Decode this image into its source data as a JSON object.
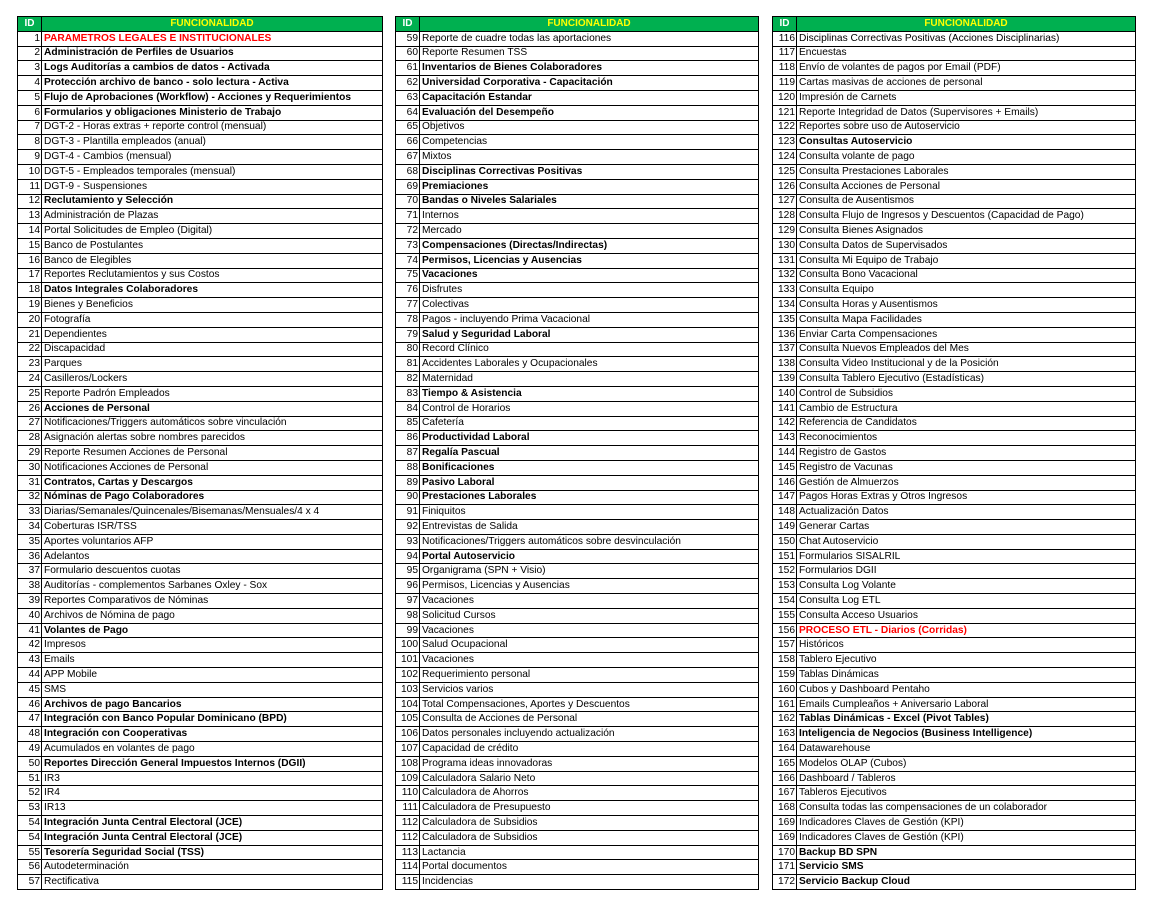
{
  "header": {
    "id_label": "ID",
    "func_label": "FUNCIONALIDAD"
  },
  "colors": {
    "header_bg": "#00b050",
    "header_text": "#ffff00",
    "red_text": "#ff0000"
  },
  "tables": [
    [
      {
        "id": "1",
        "t": "PARAMETROS LEGALES E INSTITUCIONALES",
        "s": "r"
      },
      {
        "id": "2",
        "t": "Administración de Perfiles de Usuarios",
        "s": "b"
      },
      {
        "id": "3",
        "t": "Logs Auditorías a cambios de datos - Activada",
        "s": "b"
      },
      {
        "id": "4",
        "t": "Protección archivo de banco - solo lectura - Activa",
        "s": "b"
      },
      {
        "id": "5",
        "t": "Flujo de Aprobaciones (Workflow) - Acciones y Requerimientos",
        "s": "b"
      },
      {
        "id": "6",
        "t": "Formularios y obligaciones Ministerio de Trabajo",
        "s": "b"
      },
      {
        "id": "7",
        "t": "DGT-2 - Horas extras + reporte control (mensual)",
        "s": ""
      },
      {
        "id": "8",
        "t": "DGT-3 - Plantilla empleados (anual)",
        "s": ""
      },
      {
        "id": "9",
        "t": "DGT-4 - Cambios (mensual)",
        "s": ""
      },
      {
        "id": "10",
        "t": "DGT-5 - Empleados temporales (mensual)",
        "s": ""
      },
      {
        "id": "11",
        "t": "DGT-9 - Suspensiones",
        "s": ""
      },
      {
        "id": "12",
        "t": "Reclutamiento y Selección",
        "s": "b"
      },
      {
        "id": "13",
        "t": "Administración de Plazas",
        "s": ""
      },
      {
        "id": "14",
        "t": "Portal Solicitudes de Empleo (Digital)",
        "s": ""
      },
      {
        "id": "15",
        "t": "Banco de Postulantes",
        "s": ""
      },
      {
        "id": "16",
        "t": "Banco de Elegibles",
        "s": ""
      },
      {
        "id": "17",
        "t": "Reportes Reclutamientos y sus Costos",
        "s": ""
      },
      {
        "id": "18",
        "t": "Datos Integrales Colaboradores",
        "s": "b"
      },
      {
        "id": "19",
        "t": "Bienes y Beneficios",
        "s": ""
      },
      {
        "id": "20",
        "t": "Fotografía",
        "s": ""
      },
      {
        "id": "21",
        "t": "Dependientes",
        "s": ""
      },
      {
        "id": "22",
        "t": "Discapacidad",
        "s": ""
      },
      {
        "id": "23",
        "t": "Parques",
        "s": ""
      },
      {
        "id": "24",
        "t": "Casilleros/Lockers",
        "s": ""
      },
      {
        "id": "25",
        "t": "Reporte Padrón Empleados",
        "s": ""
      },
      {
        "id": "26",
        "t": "Acciones de Personal",
        "s": "b"
      },
      {
        "id": "27",
        "t": "Notificaciones/Triggers automáticos sobre vinculación",
        "s": ""
      },
      {
        "id": "28",
        "t": "Asignación alertas sobre nombres parecidos",
        "s": ""
      },
      {
        "id": "29",
        "t": "Reporte Resumen Acciones de Personal",
        "s": ""
      },
      {
        "id": "30",
        "t": "Notificaciones Acciones de Personal",
        "s": ""
      },
      {
        "id": "31",
        "t": "Contratos, Cartas y Descargos",
        "s": "b"
      },
      {
        "id": "32",
        "t": "Nóminas de Pago Colaboradores",
        "s": "b"
      },
      {
        "id": "33",
        "t": "Diarias/Semanales/Quincenales/Bisemanas/Mensuales/4 x 4",
        "s": ""
      },
      {
        "id": "34",
        "t": "Coberturas ISR/TSS",
        "s": ""
      },
      {
        "id": "35",
        "t": "Aportes voluntarios AFP",
        "s": ""
      },
      {
        "id": "36",
        "t": "Adelantos",
        "s": ""
      },
      {
        "id": "37",
        "t": "Formulario descuentos cuotas",
        "s": ""
      },
      {
        "id": "38",
        "t": "Auditorías - complementos Sarbanes Oxley - Sox",
        "s": ""
      },
      {
        "id": "39",
        "t": "Reportes Comparativos de Nóminas",
        "s": ""
      },
      {
        "id": "40",
        "t": "Archivos de Nómina de pago",
        "s": ""
      },
      {
        "id": "41",
        "t": "Volantes de Pago",
        "s": "b"
      },
      {
        "id": "42",
        "t": "Impresos",
        "s": ""
      },
      {
        "id": "43",
        "t": "Emails",
        "s": ""
      },
      {
        "id": "44",
        "t": "APP Mobile",
        "s": ""
      },
      {
        "id": "45",
        "t": "SMS",
        "s": ""
      },
      {
        "id": "46",
        "t": "Archivos de pago Bancarios",
        "s": "b"
      },
      {
        "id": "47",
        "t": "Integración con Banco Popular Dominicano (BPD)",
        "s": "b"
      },
      {
        "id": "48",
        "t": "Integración con Cooperativas",
        "s": "b"
      },
      {
        "id": "49",
        "t": "Acumulados en volantes de pago",
        "s": ""
      },
      {
        "id": "50",
        "t": "Reportes Dirección General Impuestos Internos (DGII)",
        "s": "b"
      },
      {
        "id": "51",
        "t": "IR3",
        "s": ""
      },
      {
        "id": "52",
        "t": "IR4",
        "s": ""
      },
      {
        "id": "53",
        "t": "IR13",
        "s": ""
      },
      {
        "id": "54",
        "t": "Integración Junta Central Electoral (JCE)",
        "s": "b"
      },
      {
        "id": "54",
        "t": "Integración Junta Central Electoral (JCE)",
        "s": "b"
      },
      {
        "id": "55",
        "t": "Tesorería Seguridad Social (TSS)",
        "s": "b"
      },
      {
        "id": "56",
        "t": "Autodeterminación",
        "s": ""
      },
      {
        "id": "57",
        "t": "Rectificativa",
        "s": ""
      }
    ],
    [
      {
        "id": "59",
        "t": "Reporte de cuadre todas las aportaciones",
        "s": ""
      },
      {
        "id": "60",
        "t": "Reporte Resumen TSS",
        "s": ""
      },
      {
        "id": "61",
        "t": "Inventarios de Bienes Colaboradores",
        "s": "b"
      },
      {
        "id": "62",
        "t": "Universidad Corporativa - Capacitación",
        "s": "b"
      },
      {
        "id": "63",
        "t": "Capacitación Estandar",
        "s": "b"
      },
      {
        "id": "64",
        "t": "Evaluación del Desempeño",
        "s": "b"
      },
      {
        "id": "65",
        "t": "Objetivos",
        "s": ""
      },
      {
        "id": "66",
        "t": "Competencias",
        "s": ""
      },
      {
        "id": "67",
        "t": "Mixtos",
        "s": ""
      },
      {
        "id": "68",
        "t": "Disciplinas Correctivas Positivas",
        "s": "b"
      },
      {
        "id": "69",
        "t": "Premiaciones",
        "s": "b"
      },
      {
        "id": "70",
        "t": "Bandas o Niveles Salariales",
        "s": "b"
      },
      {
        "id": "71",
        "t": "Internos",
        "s": ""
      },
      {
        "id": "72",
        "t": "Mercado",
        "s": ""
      },
      {
        "id": "73",
        "t": "Compensaciones (Directas/Indirectas)",
        "s": "b"
      },
      {
        "id": "74",
        "t": "Permisos, Licencias y Ausencias",
        "s": "b"
      },
      {
        "id": "75",
        "t": "Vacaciones",
        "s": "b"
      },
      {
        "id": "76",
        "t": "Disfrutes",
        "s": ""
      },
      {
        "id": "77",
        "t": "Colectivas",
        "s": ""
      },
      {
        "id": "78",
        "t": "Pagos - incluyendo Prima Vacacional",
        "s": ""
      },
      {
        "id": "79",
        "t": "Salud y Seguridad Laboral",
        "s": "b"
      },
      {
        "id": "80",
        "t": "Record Clínico",
        "s": ""
      },
      {
        "id": "81",
        "t": "Accidentes Laborales y Ocupacionales",
        "s": ""
      },
      {
        "id": "82",
        "t": "Maternidad",
        "s": ""
      },
      {
        "id": "83",
        "t": "Tiempo & Asistencia",
        "s": "b"
      },
      {
        "id": "84",
        "t": "Control de Horarios",
        "s": ""
      },
      {
        "id": "85",
        "t": "Cafetería",
        "s": ""
      },
      {
        "id": "86",
        "t": "Productividad Laboral",
        "s": "b"
      },
      {
        "id": "87",
        "t": "Regalía Pascual",
        "s": "b"
      },
      {
        "id": "88",
        "t": "Bonificaciones",
        "s": "b"
      },
      {
        "id": "89",
        "t": "Pasivo Laboral",
        "s": "b"
      },
      {
        "id": "90",
        "t": "Prestaciones Laborales",
        "s": "b"
      },
      {
        "id": "91",
        "t": "Finiquitos",
        "s": ""
      },
      {
        "id": "92",
        "t": "Entrevistas de Salida",
        "s": ""
      },
      {
        "id": "93",
        "t": "Notificaciones/Triggers automáticos sobre desvinculación",
        "s": ""
      },
      {
        "id": "94",
        "t": "Portal Autoservicio",
        "s": "b"
      },
      {
        "id": "95",
        "t": "Organigrama (SPN + Visio)",
        "s": ""
      },
      {
        "id": "96",
        "t": "Permisos, Licencias y Ausencias",
        "s": ""
      },
      {
        "id": "97",
        "t": "Vacaciones",
        "s": ""
      },
      {
        "id": "98",
        "t": "Solicitud Cursos",
        "s": ""
      },
      {
        "id": "99",
        "t": "Vacaciones",
        "s": ""
      },
      {
        "id": "100",
        "t": "Salud Ocupacional",
        "s": ""
      },
      {
        "id": "101",
        "t": "Vacaciones",
        "s": ""
      },
      {
        "id": "102",
        "t": "Requerimiento personal",
        "s": ""
      },
      {
        "id": "103",
        "t": "Servicios varios",
        "s": ""
      },
      {
        "id": "104",
        "t": "Total Compensaciones, Aportes y Descuentos",
        "s": ""
      },
      {
        "id": "105",
        "t": "Consulta de Acciones de Personal",
        "s": ""
      },
      {
        "id": "106",
        "t": "Datos personales incluyendo actualización",
        "s": ""
      },
      {
        "id": "107",
        "t": "Capacidad de crédito",
        "s": ""
      },
      {
        "id": "108",
        "t": "Programa ideas innovadoras",
        "s": ""
      },
      {
        "id": "109",
        "t": "Calculadora Salario Neto",
        "s": ""
      },
      {
        "id": "110",
        "t": "Calculadora de Ahorros",
        "s": ""
      },
      {
        "id": "111",
        "t": "Calculadora de Presupuesto",
        "s": ""
      },
      {
        "id": "112",
        "t": "Calculadora de Subsidios",
        "s": ""
      },
      {
        "id": "112",
        "t": "Calculadora de Subsidios",
        "s": ""
      },
      {
        "id": "113",
        "t": "Lactancia",
        "s": ""
      },
      {
        "id": "114",
        "t": "Portal documentos",
        "s": ""
      },
      {
        "id": "115",
        "t": "Incidencias",
        "s": ""
      }
    ],
    [
      {
        "id": "116",
        "t": "Disciplinas Correctivas Positivas (Acciones Disciplinarias)",
        "s": ""
      },
      {
        "id": "117",
        "t": "Encuestas",
        "s": ""
      },
      {
        "id": "118",
        "t": "Envío de volantes de pagos por Email (PDF)",
        "s": ""
      },
      {
        "id": "119",
        "t": "Cartas masivas de acciones de personal",
        "s": ""
      },
      {
        "id": "120",
        "t": "Impresión de Carnets",
        "s": ""
      },
      {
        "id": "121",
        "t": "Reporte Integridad de Datos (Supervisores + Emails)",
        "s": ""
      },
      {
        "id": "122",
        "t": "Reportes sobre uso de Autoservicio",
        "s": ""
      },
      {
        "id": "123",
        "t": "Consultas Autoservicio",
        "s": "b"
      },
      {
        "id": "124",
        "t": "Consulta volante de pago",
        "s": ""
      },
      {
        "id": "125",
        "t": "Consulta Prestaciones Laborales",
        "s": ""
      },
      {
        "id": "126",
        "t": "Consulta Acciones de Personal",
        "s": ""
      },
      {
        "id": "127",
        "t": "Consulta de Ausentismos",
        "s": ""
      },
      {
        "id": "128",
        "t": "Consulta Flujo de Ingresos y Descuentos (Capacidad de Pago)",
        "s": ""
      },
      {
        "id": "129",
        "t": "Consulta Bienes Asignados",
        "s": ""
      },
      {
        "id": "130",
        "t": "Consulta Datos de Supervisados",
        "s": ""
      },
      {
        "id": "131",
        "t": "Consulta Mi Equipo de Trabajo",
        "s": ""
      },
      {
        "id": "132",
        "t": "Consulta Bono Vacacional",
        "s": ""
      },
      {
        "id": "133",
        "t": "Consulta Equipo",
        "s": ""
      },
      {
        "id": "134",
        "t": "Consulta Horas y Ausentismos",
        "s": ""
      },
      {
        "id": "135",
        "t": "Consulta Mapa Facilidades",
        "s": ""
      },
      {
        "id": "136",
        "t": "Enviar Carta Compensaciones",
        "s": ""
      },
      {
        "id": "137",
        "t": "Consulta Nuevos Empleados del Mes",
        "s": ""
      },
      {
        "id": "138",
        "t": "Consulta Video Institucional y de la Posición",
        "s": ""
      },
      {
        "id": "139",
        "t": "Consulta Tablero Ejecutivo (Estadísticas)",
        "s": ""
      },
      {
        "id": "140",
        "t": "Control de Subsidios",
        "s": ""
      },
      {
        "id": "141",
        "t": "Cambio de Estructura",
        "s": ""
      },
      {
        "id": "142",
        "t": "Referencia de Candidatos",
        "s": ""
      },
      {
        "id": "143",
        "t": "Reconocimientos",
        "s": ""
      },
      {
        "id": "144",
        "t": "Registro de Gastos",
        "s": ""
      },
      {
        "id": "145",
        "t": "Registro de Vacunas",
        "s": ""
      },
      {
        "id": "146",
        "t": "Gestión de Almuerzos",
        "s": ""
      },
      {
        "id": "147",
        "t": "Pagos Horas Extras y Otros Ingresos",
        "s": ""
      },
      {
        "id": "148",
        "t": "Actualización Datos",
        "s": ""
      },
      {
        "id": "149",
        "t": "Generar Cartas",
        "s": ""
      },
      {
        "id": "150",
        "t": "Chat Autoservicio",
        "s": ""
      },
      {
        "id": "151",
        "t": "Formularios SISALRIL",
        "s": ""
      },
      {
        "id": "152",
        "t": "Formularios DGII",
        "s": ""
      },
      {
        "id": "153",
        "t": "Consulta Log Volante",
        "s": ""
      },
      {
        "id": "154",
        "t": "Consulta Log ETL",
        "s": ""
      },
      {
        "id": "155",
        "t": "Consulta Acceso Usuarios",
        "s": ""
      },
      {
        "id": "156",
        "t": "PROCESO ETL - Diarios (Corridas)",
        "s": "r"
      },
      {
        "id": "157",
        "t": "Históricos",
        "s": ""
      },
      {
        "id": "158",
        "t": "Tablero Ejecutivo",
        "s": ""
      },
      {
        "id": "159",
        "t": "Tablas Dinámicas",
        "s": ""
      },
      {
        "id": "160",
        "t": "Cubos y Dashboard Pentaho",
        "s": ""
      },
      {
        "id": "161",
        "t": "Emails Cumpleaños + Aniversario Laboral",
        "s": ""
      },
      {
        "id": "162",
        "t": "Tablas Dinámicas - Excel (Pivot Tables)",
        "s": "b"
      },
      {
        "id": "163",
        "t": "Inteligencia de Negocios (Business Intelligence)",
        "s": "b"
      },
      {
        "id": "164",
        "t": "Datawarehouse",
        "s": ""
      },
      {
        "id": "165",
        "t": "Modelos OLAP (Cubos)",
        "s": ""
      },
      {
        "id": "166",
        "t": "Dashboard / Tableros",
        "s": ""
      },
      {
        "id": "167",
        "t": "Tableros Ejecutivos",
        "s": ""
      },
      {
        "id": "168",
        "t": "Consulta todas las compensaciones de un colaborador",
        "s": ""
      },
      {
        "id": "169",
        "t": "Indicadores Claves de Gestión (KPI)",
        "s": ""
      },
      {
        "id": "169",
        "t": "Indicadores Claves de Gestión (KPI)",
        "s": ""
      },
      {
        "id": "170",
        "t": "Backup BD SPN",
        "s": "b"
      },
      {
        "id": "171",
        "t": "Servicio SMS",
        "s": "b"
      },
      {
        "id": "172",
        "t": "Servicio Backup Cloud",
        "s": "b"
      }
    ]
  ]
}
